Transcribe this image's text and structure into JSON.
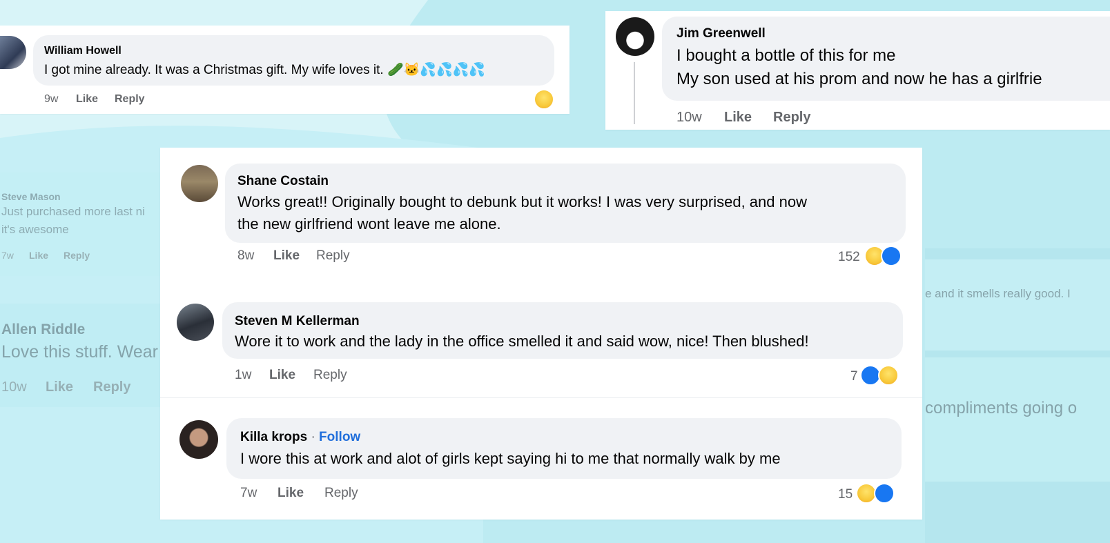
{
  "comments": {
    "william": {
      "name": "William Howell",
      "text": "I got mine already. It was a Christmas gift. My wife loves it. 🥒🐱💦💦💦💦",
      "time": "9w",
      "like": "Like",
      "reply": "Reply"
    },
    "jim": {
      "name": "Jim Greenwell",
      "line1": "I bought a bottle of this for me",
      "line2": "My son used at his prom and now he has a girlfrie",
      "time": "10w",
      "like": "Like",
      "reply": "Reply"
    },
    "steve_mason": {
      "name": "Steve Mason",
      "line1": "Just purchased more last ni",
      "line2": "it's awesome",
      "time": "7w",
      "like": "Like",
      "reply": "Reply"
    },
    "allen": {
      "name": "Allen Riddle",
      "text": "Love this stuff. Wear",
      "time": "10w",
      "like": "Like",
      "reply": "Reply"
    },
    "shane": {
      "name": "Shane Costain",
      "line1": "Works great!! Originally bought to debunk but it works! I was very surprised, and now",
      "line2": "the new girlfriend wont leave me alone.",
      "time": "8w",
      "like": "Like",
      "reply": "Reply",
      "reactions": "152"
    },
    "steven": {
      "name": "Steven M Kellerman",
      "text": "Wore it to work and the lady in the office smelled it and said wow, nice! Then blushed!",
      "time": "1w",
      "like": "Like",
      "reply": "Reply",
      "reactions": "7"
    },
    "killa": {
      "name": "Killa krops",
      "separator": "·",
      "follow": "Follow",
      "text": "I wore this at work and alot of girls kept saying hi to me that normally walk by me",
      "time": "7w",
      "like": "Like",
      "reply": "Reply",
      "reactions": "15"
    }
  },
  "background_fragments": {
    "right1": "e and it smells really good. I",
    "right2": "compliments going o"
  },
  "colors": {
    "background": "#b9ebf3",
    "bubble": "#f0f2f5",
    "meta_text": "#65676b",
    "follow": "#216fdb",
    "like_blue": "#1877f2",
    "haha_yellow": "#f8c93a"
  }
}
